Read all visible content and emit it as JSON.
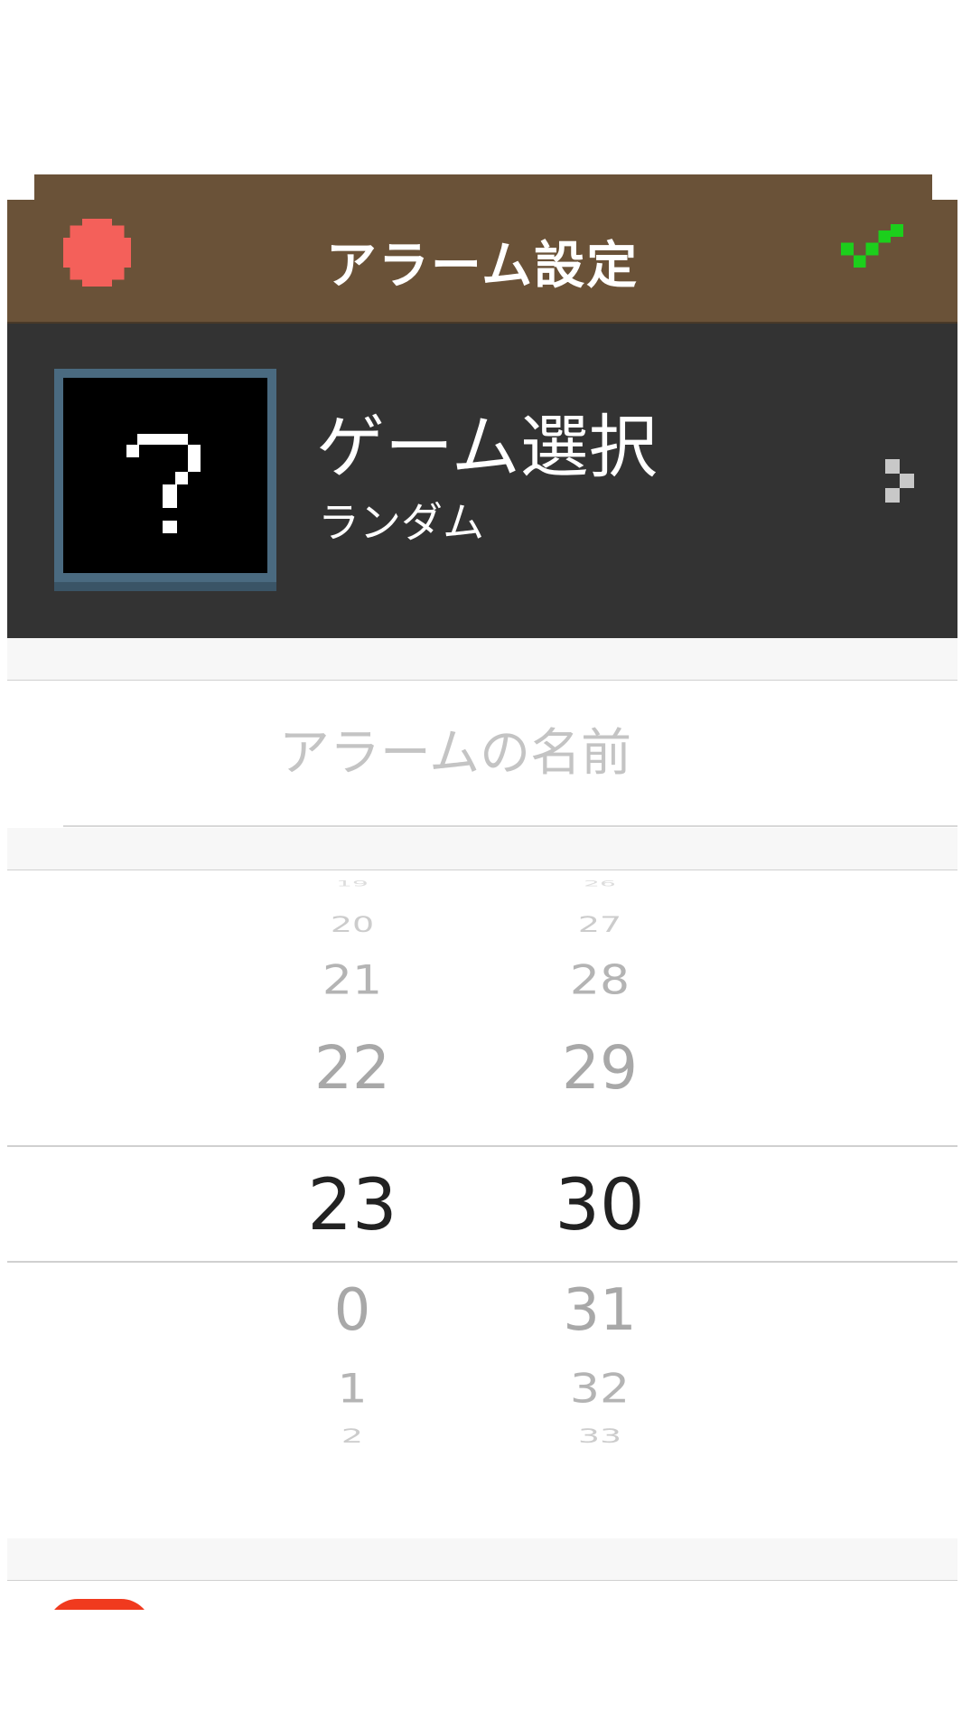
{
  "header": {
    "title": "アラーム設定",
    "cancel_icon": "pixel-cross-icon",
    "confirm_icon": "pixel-check-icon",
    "bg_color": "#6a5238",
    "cancel_color": "#f4605a",
    "confirm_color": "#1ccf1c"
  },
  "game_select": {
    "title": "ゲーム選択",
    "value": "ランダム",
    "thumbnail_glyph": "?",
    "chevron_icon": "pixel-chevron-right-icon",
    "bg_color": "#333333"
  },
  "alarm_name": {
    "placeholder": "アラームの名前",
    "value": ""
  },
  "time_picker": {
    "hours": [
      "20",
      "21",
      "22",
      "23",
      "0",
      "1",
      "2"
    ],
    "minutes": [
      "27",
      "28",
      "29",
      "30",
      "31",
      "32",
      "33"
    ],
    "selected_hour": "23",
    "selected_minute": "30"
  },
  "bottom_item": {
    "icon": "red-rounded-icon",
    "color": "#f03a1e"
  }
}
